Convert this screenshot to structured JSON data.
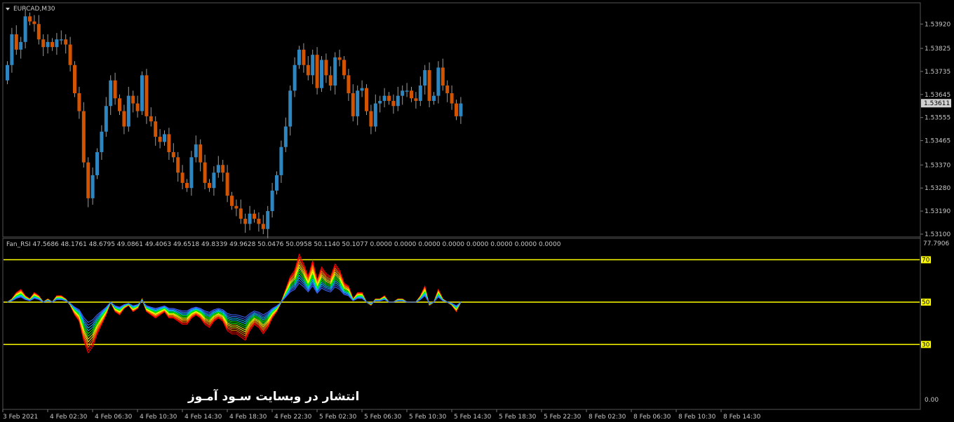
{
  "chart_data": [
    {
      "type": "candlestick",
      "title": "EURCAD,M30",
      "ylim": [
        1.531,
        1.5397
      ],
      "y_ticks": [
        "1.53920",
        "1.53825",
        "1.53735",
        "1.53645",
        "1.53555",
        "1.53465",
        "1.53370",
        "1.53280",
        "1.53190",
        "1.53100"
      ],
      "last_price": "1.53611",
      "x_ticks": [
        "3 Feb 2021",
        "4 Feb 02:30",
        "4 Feb 06:30",
        "4 Feb 10:30",
        "4 Feb 14:30",
        "4 Feb 18:30",
        "4 Feb 22:30",
        "5 Feb 02:30",
        "5 Feb 06:30",
        "5 Feb 10:30",
        "5 Feb 14:30",
        "5 Feb 18:30",
        "5 Feb 22:30",
        "8 Feb 02:30",
        "8 Feb 06:30",
        "8 Feb 10:30",
        "8 Feb 14:30"
      ],
      "close": [
        1.5376,
        1.5388,
        1.5382,
        1.5385,
        1.5395,
        1.5393,
        1.5392,
        1.5386,
        1.5383,
        1.5385,
        1.5383,
        1.5386,
        1.5386,
        1.5384,
        1.5376,
        1.5365,
        1.5358,
        1.5338,
        1.5324,
        1.5333,
        1.5342,
        1.535,
        1.536,
        1.537,
        1.5363,
        1.5358,
        1.5352,
        1.5364,
        1.5361,
        1.5358,
        1.5372,
        1.5356,
        1.5354,
        1.5348,
        1.5346,
        1.5349,
        1.5342,
        1.534,
        1.5334,
        1.533,
        1.5328,
        1.534,
        1.5345,
        1.5338,
        1.533,
        1.5328,
        1.5334,
        1.5337,
        1.5334,
        1.5325,
        1.5321,
        1.532,
        1.5316,
        1.5314,
        1.5318,
        1.5316,
        1.5314,
        1.5312,
        1.5319,
        1.5327,
        1.5333,
        1.5344,
        1.5352,
        1.5366,
        1.5376,
        1.5382,
        1.5376,
        1.5372,
        1.538,
        1.5367,
        1.5378,
        1.5372,
        1.5368,
        1.5379,
        1.5378,
        1.5372,
        1.5365,
        1.5356,
        1.5366,
        1.5367,
        1.5358,
        1.5352,
        1.5361,
        1.5362,
        1.5364,
        1.5362,
        1.536,
        1.5364,
        1.5366,
        1.5366,
        1.5363,
        1.5362,
        1.5368,
        1.5374,
        1.5362,
        1.5364,
        1.5375,
        1.5368,
        1.5365,
        1.5361,
        1.5356,
        1.5361
      ],
      "open": [
        1.537,
        1.5376,
        1.5388,
        1.5382,
        1.5385,
        1.5395,
        1.5393,
        1.5392,
        1.5386,
        1.5383,
        1.5385,
        1.5383,
        1.5386,
        1.5386,
        1.5384,
        1.5376,
        1.5365,
        1.5358,
        1.5338,
        1.5324,
        1.5333,
        1.5342,
        1.535,
        1.536,
        1.537,
        1.5363,
        1.5358,
        1.5352,
        1.5364,
        1.5361,
        1.5358,
        1.5372,
        1.5356,
        1.5354,
        1.5348,
        1.5346,
        1.5349,
        1.5342,
        1.534,
        1.5334,
        1.533,
        1.5328,
        1.534,
        1.5345,
        1.5338,
        1.533,
        1.5328,
        1.5334,
        1.5337,
        1.5334,
        1.5325,
        1.5321,
        1.532,
        1.5316,
        1.5314,
        1.5318,
        1.5316,
        1.5314,
        1.5312,
        1.5319,
        1.5327,
        1.5333,
        1.5344,
        1.5352,
        1.5366,
        1.5376,
        1.5382,
        1.5376,
        1.5372,
        1.538,
        1.5367,
        1.5378,
        1.5372,
        1.5368,
        1.5379,
        1.5378,
        1.5372,
        1.5365,
        1.5356,
        1.5366,
        1.5367,
        1.5358,
        1.5352,
        1.5361,
        1.5362,
        1.5364,
        1.5362,
        1.536,
        1.5364,
        1.5366,
        1.5366,
        1.5363,
        1.5362,
        1.5368,
        1.5374,
        1.5362,
        1.5364,
        1.5375,
        1.5368,
        1.5365,
        1.5361,
        1.5356
      ],
      "up_color": "#2e86c1",
      "down_color": "#d35400",
      "background": "#000000"
    },
    {
      "type": "line",
      "title": "Fan_RSI 47.5686 48.1761 48.6795 49.0861 49.4063 49.6518 49.8339 49.9628 50.0476 50.0958 50.1140 50.1077 0.0000 0.0000 0.0000 0.0000 0.0000 0.0000 0.0000 0.0000",
      "ylim": [
        0,
        77.7906
      ],
      "y_ticks": [
        "77.7906",
        "0.00"
      ],
      "levels": [
        "70",
        "50",
        "30"
      ],
      "level_color": "#ffff00",
      "colors": [
        "#ff0000",
        "#ff8000",
        "#ffff00",
        "#00ff00",
        "#00c8ff",
        "#3c64ff"
      ],
      "rsi_base": [
        50,
        51,
        53,
        54,
        52,
        51,
        53,
        52,
        50,
        51,
        50,
        52,
        52,
        51,
        49,
        46,
        44,
        38,
        34,
        36,
        40,
        43,
        46,
        50,
        47,
        46,
        48,
        49,
        47,
        48,
        51,
        47,
        46,
        45,
        46,
        47,
        45,
        45,
        44,
        43,
        43,
        45,
        46,
        45,
        43,
        42,
        44,
        45,
        44,
        41,
        40,
        40,
        39,
        38,
        41,
        43,
        42,
        40,
        42,
        45,
        47,
        50,
        54,
        58,
        60,
        65,
        62,
        58,
        63,
        57,
        61,
        59,
        58,
        62,
        60,
        56,
        55,
        51,
        53,
        53,
        50,
        49,
        51,
        51,
        52,
        50,
        50,
        51,
        51,
        50,
        50,
        50,
        52,
        55,
        49,
        50,
        54,
        51,
        50,
        49,
        47,
        50
      ],
      "fan_spreads": [
        1.0,
        0.8,
        0.6,
        0.4,
        0.2,
        0.0
      ]
    }
  ],
  "watermark": "انتشار در وبسایت سـود آمـوز",
  "header": {
    "symbol_label": "EURCAD,M30"
  }
}
